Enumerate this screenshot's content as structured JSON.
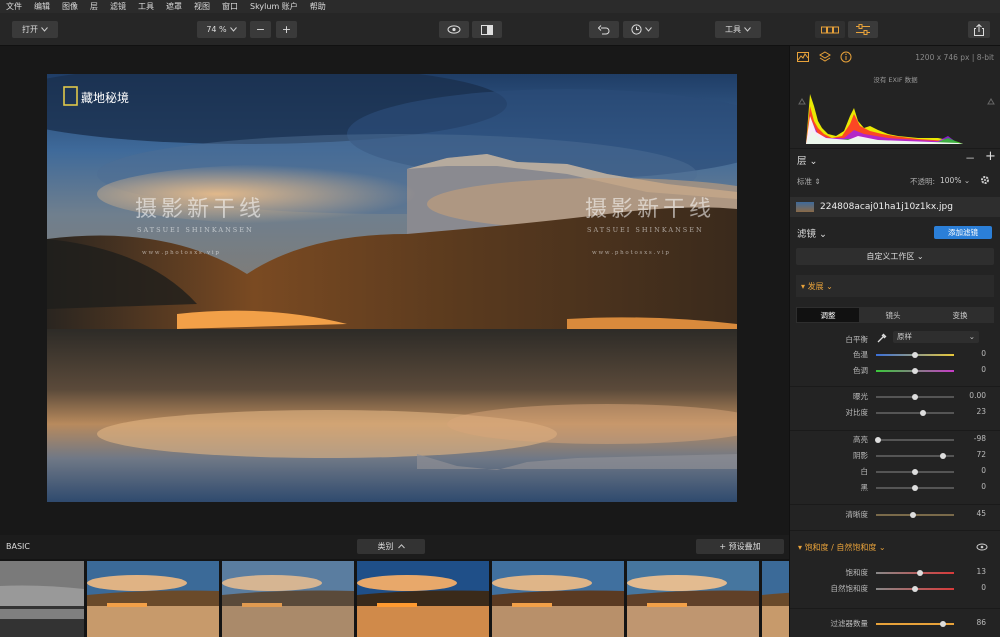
{
  "menu": [
    "文件",
    "编辑",
    "图像",
    "层",
    "滤镜",
    "工具",
    "遮罩",
    "视图",
    "窗口",
    "Skylum 账户",
    "帮助"
  ],
  "toolbar": {
    "open_label": "打开",
    "zoom_value": "74 %",
    "zoom_out": "−",
    "zoom_in": "+",
    "tools_label": "工具"
  },
  "image_info": {
    "dimensions": "1200 x 746 px  |  8-bit",
    "exif": "没有 EXIF 数据"
  },
  "watermark": {
    "logo_text": "藏地秘境",
    "main_text": "摄影新干线",
    "sub_text": "SATSUEI SHINKANSEN",
    "url_text": "w w w . p h o t o s x s . v i p"
  },
  "layers": {
    "title": "层",
    "blend_mode": "标准",
    "opacity_label": "不透明:",
    "opacity_value": "100%",
    "file_name": "224808acaj01ha1j10z1kx.jpg"
  },
  "filters": {
    "title": "滤镜",
    "add_label": "添加滤镜",
    "workspace_label": "自定义工作区",
    "develop_title": "发展",
    "tabs": [
      "调整",
      "镜头",
      "变换"
    ],
    "wb_label": "白平衡",
    "wb_value": "原样",
    "saturation_title": "饱和度 / 自然饱和度"
  },
  "sliders": {
    "temperature": {
      "label": "色温",
      "value": "0",
      "level": 0.5
    },
    "tint": {
      "label": "色调",
      "value": "0",
      "level": 0.5
    },
    "exposure": {
      "label": "曝光",
      "value": "0.00",
      "level": 0.5
    },
    "contrast": {
      "label": "对比度",
      "value": "23",
      "level": 0.6
    },
    "highlights": {
      "label": "高亮",
      "value": "-98",
      "level": 0.02
    },
    "shadows": {
      "label": "阴影",
      "value": "72",
      "level": 0.86
    },
    "whites": {
      "label": "白",
      "value": "0",
      "level": 0.5
    },
    "blacks": {
      "label": "黑",
      "value": "0",
      "level": 0.5
    },
    "clarity": {
      "label": "清晰度",
      "value": "45",
      "level": 0.48
    },
    "saturation": {
      "label": "饱和度",
      "value": "13",
      "level": 0.56
    },
    "vibrance": {
      "label": "自然饱和度",
      "value": "0",
      "level": 0.5
    },
    "filter_amount": {
      "label": "过滤器数量",
      "value": "86",
      "level": 0.86
    }
  },
  "filmstrip": {
    "category": "BASIC",
    "type_label": "类别",
    "add_preset_label": "+ 预设叠加"
  },
  "colors": {
    "accent": "#2b7fd8",
    "orange": "#e8a23a",
    "panel_bg": "#232323"
  }
}
